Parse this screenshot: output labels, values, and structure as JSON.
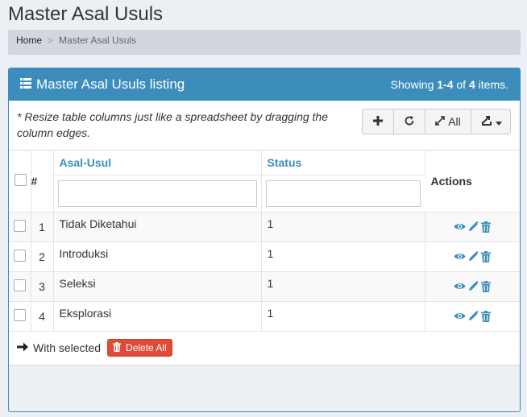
{
  "page": {
    "title": "Master Asal Usuls"
  },
  "breadcrumb": {
    "home": "Home",
    "separator": ">",
    "current": "Master Asal Usuls"
  },
  "panel": {
    "title": "Master Asal Usuls listing",
    "summary_prefix": "Showing ",
    "summary_range": "1-4",
    "summary_mid": " of ",
    "summary_total": "4",
    "summary_suffix": " items."
  },
  "toolbar": {
    "hint": "* Resize table columns just like a spreadsheet by dragging the column edges.",
    "buttons": [
      {
        "icon": "plus-icon"
      },
      {
        "icon": "refresh-icon"
      },
      {
        "icon": "expand-icon",
        "label": "All"
      },
      {
        "icon": "export-icon"
      }
    ]
  },
  "table": {
    "columns": {
      "number": "#",
      "asal_usul": "Asal-Usul",
      "status": "Status",
      "actions": "Actions"
    },
    "filters": {
      "asal_usul": "",
      "status": ""
    },
    "rows": [
      {
        "no": "1",
        "asal_usul": "Tidak Diketahui",
        "status": "1"
      },
      {
        "no": "2",
        "asal_usul": "Introduksi",
        "status": "1"
      },
      {
        "no": "3",
        "asal_usul": "Seleksi",
        "status": "1"
      },
      {
        "no": "4",
        "asal_usul": "Eksplorasi",
        "status": "1"
      }
    ],
    "row_actions": [
      "view-icon",
      "edit-icon",
      "delete-icon"
    ]
  },
  "footer": {
    "with_selected": "With selected",
    "delete_all": "Delete All"
  },
  "colors": {
    "primary": "#3c8dbc",
    "danger": "#dd4b39",
    "background": "#ecf0f5"
  }
}
